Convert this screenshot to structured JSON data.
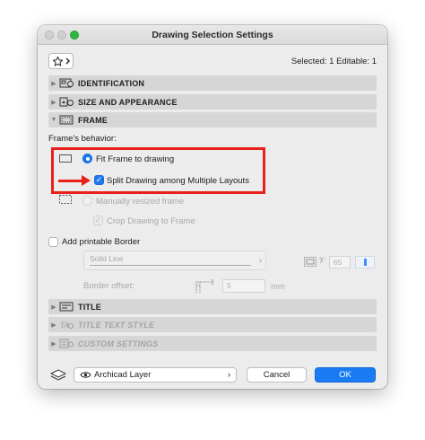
{
  "window": {
    "title": "Drawing Selection Settings"
  },
  "toolbar": {
    "favorites_icon": "star-icon",
    "selected_info": "Selected: 1 Editable: 1"
  },
  "sections": {
    "identification": "IDENTIFICATION",
    "size_appearance": "SIZE AND APPEARANCE",
    "frame": "FRAME",
    "title": "TITLE",
    "title_text_style": "TITLE TEXT STYLE",
    "custom_settings": "CUSTOM SETTINGS"
  },
  "frame": {
    "behavior_label": "Frame's behavior:",
    "fit_frame_label": "Fit Frame to drawing",
    "fit_frame_selected": true,
    "split_drawing_label": "Split Drawing among Multiple Layouts",
    "split_drawing_checked": true,
    "manual_frame_label": "Manually resized frame",
    "crop_label": "Crop Drawing to Frame",
    "crop_checked": true,
    "printable_border_label": "Add printable Border",
    "printable_border_checked": false,
    "line_type_value": "Solid Line",
    "pen_value": "65",
    "border_offset_label": "Border offset:",
    "border_offset_value": "5",
    "border_offset_unit": "mm"
  },
  "footer": {
    "layer_value": "Archicad Layer",
    "cancel_label": "Cancel",
    "ok_label": "OK"
  },
  "colors": {
    "accent": "#1a7cf5",
    "highlight": "#e8221b"
  }
}
